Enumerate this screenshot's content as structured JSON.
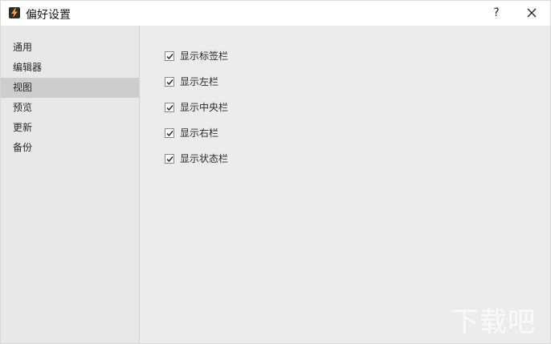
{
  "window": {
    "title": "偏好设置",
    "help_label": "?",
    "icons": {
      "app": "lightning-icon",
      "close": "close-icon"
    }
  },
  "sidebar": {
    "items": [
      {
        "label": "通用",
        "selected": false
      },
      {
        "label": "编辑器",
        "selected": false
      },
      {
        "label": "视图",
        "selected": true
      },
      {
        "label": "预览",
        "selected": false
      },
      {
        "label": "更新",
        "selected": false
      },
      {
        "label": "备份",
        "selected": false
      }
    ]
  },
  "view_settings": {
    "options": [
      {
        "label": "显示标签栏",
        "checked": true
      },
      {
        "label": "显示左栏",
        "checked": true
      },
      {
        "label": "显示中央栏",
        "checked": true
      },
      {
        "label": "显示右栏",
        "checked": true
      },
      {
        "label": "显示状态栏",
        "checked": true
      }
    ]
  },
  "watermark": {
    "text": "下载吧"
  },
  "colors": {
    "sidebar_bg": "#e7e8e9",
    "selected_bg": "#cdcdcd",
    "content_bg": "#ececec",
    "icon_accent": "#f5a623"
  }
}
